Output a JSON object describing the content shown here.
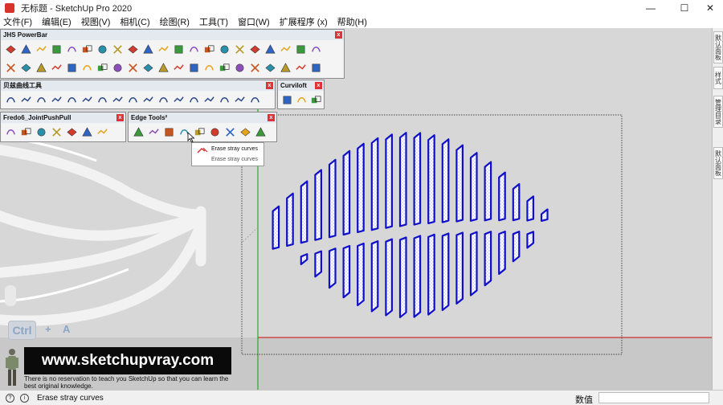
{
  "window": {
    "title": "无标题 - SketchUp Pro 2020",
    "minimize": "—",
    "maximize": "☐",
    "close": "✕"
  },
  "menu": [
    "文件(F)",
    "编辑(E)",
    "视图(V)",
    "相机(C)",
    "绘图(R)",
    "工具(T)",
    "窗口(W)",
    "扩展程序 (x)",
    "帮助(H)"
  ],
  "toolbars": {
    "jhs": {
      "title": "JHS PowerBar",
      "close": "x"
    },
    "bezier": {
      "title": "贝兹曲线工具",
      "close": "x"
    },
    "curviloft": {
      "title": "Curviloft",
      "close": "x"
    },
    "fredo": {
      "title": "Fredo6_JointPushPull",
      "close": "x"
    },
    "edge": {
      "title": "Edge Tools²",
      "close": "x"
    }
  },
  "tooltip": {
    "title": "Erase stray curves",
    "subtitle": "Erase stray curves"
  },
  "right_tray": [
    "默认面板",
    "样式",
    "管理目录",
    "默认面板"
  ],
  "keys": {
    "ctrl": "Ctrl",
    "plus": "+",
    "a": "A"
  },
  "banner": {
    "url": "www.sketchupvray.com",
    "tagline": "There is no reservation to teach you SketchUp so that you can learn the best original knowledge."
  },
  "status": {
    "text": "Erase stray curves",
    "info_icon": "i",
    "measure_label": "数值",
    "measure_value": ""
  },
  "colors": {
    "selection_blue": "#1010c8",
    "axis_green": "#2fa82f",
    "axis_red": "#cc3030",
    "close_red": "#dd3333"
  }
}
